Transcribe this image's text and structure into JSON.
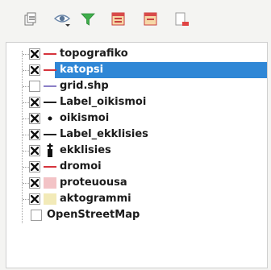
{
  "toolbar": {
    "buttons": [
      {
        "icon": "open-layer-styling-icon"
      },
      {
        "icon": "eye-visibility-icon"
      },
      {
        "icon": "filter-icon"
      },
      {
        "icon": "expand-all-icon"
      },
      {
        "icon": "collapse-all-icon"
      },
      {
        "icon": "remove-layer-icon"
      }
    ]
  },
  "layers": [
    {
      "label": "topografiko",
      "checked": true,
      "symbol": "line",
      "color": "#d6343c"
    },
    {
      "label": "katopsi",
      "checked": true,
      "symbol": "line",
      "color": "#d6343c",
      "selected": true
    },
    {
      "label": "grid.shp",
      "checked": false,
      "symbol": "line",
      "color": "#8b7fc7"
    },
    {
      "label": "Label_oikismoi",
      "checked": true,
      "symbol": "line",
      "color": "#222222"
    },
    {
      "label": "oikismoi",
      "checked": true,
      "symbol": "dot",
      "color": "#111111"
    },
    {
      "label": "Label_ekklisies",
      "checked": true,
      "symbol": "line",
      "color": "#222222"
    },
    {
      "label": "ekklisies",
      "checked": true,
      "symbol": "church",
      "color": "#111111"
    },
    {
      "label": "dromoi",
      "checked": true,
      "symbol": "line",
      "color": "#d6343c"
    },
    {
      "label": "proteuousa",
      "checked": true,
      "symbol": "fill",
      "color": "#f3c3c6"
    },
    {
      "label": "aktogrammi",
      "checked": true,
      "symbol": "fill",
      "color": "#f2eab8"
    },
    {
      "label": "OpenStreetMap",
      "checked": false,
      "symbol": "none",
      "plain": true
    }
  ]
}
